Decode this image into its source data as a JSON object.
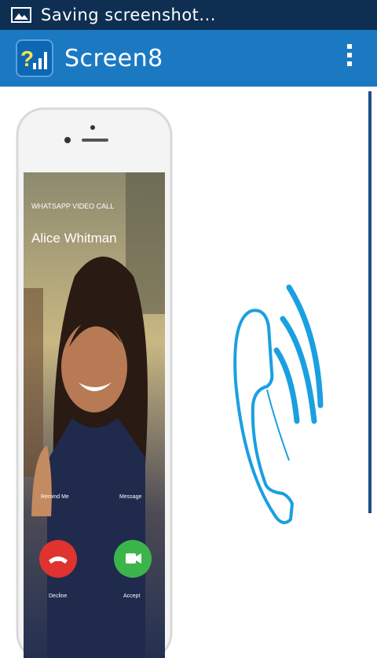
{
  "status_bar": {
    "notification_text": "Saving screenshot...",
    "icon": "image-icon"
  },
  "action_bar": {
    "title": "Screen8",
    "app_icon": "signal-question-icon",
    "menu_icon": "overflow-menu-icon"
  },
  "illustration": {
    "call_header": "WHATSAPP VIDEO CALL",
    "caller_name": "Alice Whitman",
    "remind_label": "Remind Me",
    "message_label": "Message",
    "decline_label": "Decline",
    "accept_label": "Accept",
    "colors": {
      "decline": "#e0332f",
      "accept": "#3bb54a",
      "handset": "#1aa0e0"
    }
  }
}
